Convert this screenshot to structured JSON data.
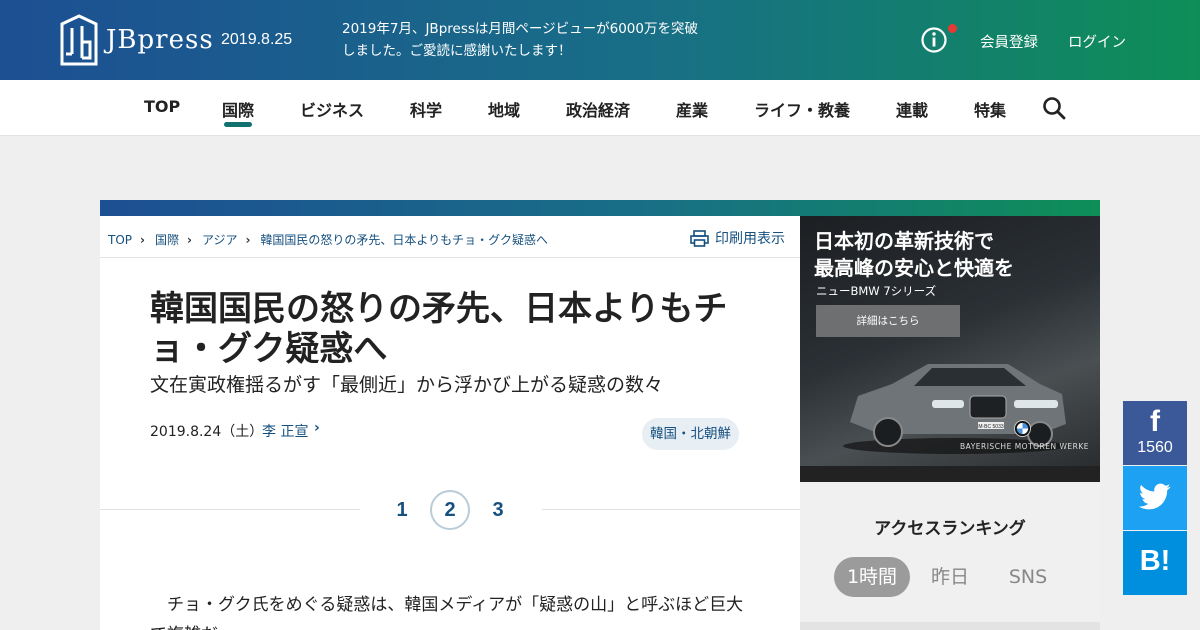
{
  "header": {
    "logo_text": "JBpress",
    "date": "2019.8.25",
    "notice": "2019年7月、JBpressは月間ページビューが6000万を突破しました。ご愛読に感謝いたします！",
    "info_icon": "info-icon",
    "register_label": "会員登録",
    "login_label": "ログイン"
  },
  "nav": {
    "items": [
      "TOP",
      "国際",
      "ビジネス",
      "科学",
      "地域",
      "政治経済",
      "産業",
      "ライフ・教養",
      "連載",
      "特集"
    ],
    "active": "国際",
    "search_icon": "search-icon"
  },
  "breadcrumb": [
    "TOP",
    "国際",
    "アジア",
    "韓国国民の怒りの矛先、日本よりもチョ・グク疑惑へ"
  ],
  "print_label": "印刷用表示",
  "article": {
    "title": "韓国国民の怒りの矛先、日本よりもチョ・グク疑惑へ",
    "subtitle": "文在寅政権揺るがす「最側近」から浮かび上がる疑惑の数々",
    "pubdate": "2019.8.24（土）",
    "author": "李 正宣",
    "tag": "韓国・北朝鮮",
    "pages": [
      "1",
      "2",
      "3"
    ],
    "current_page": "2",
    "body": "　チョ・グク氏をめぐる疑惑は、韓国メディアが「疑惑の山」と呼ぶほど巨大で複雑だ。"
  },
  "ad": {
    "headline_1": "日本初の革新技術で",
    "headline_2": "最高峰の安心と快適を",
    "sub": "ニューBMW 7シリーズ",
    "button": "詳細はこちら",
    "brand": "BAYERISCHE  MOTOREN  WERKE",
    "plate": "M·BC 5033"
  },
  "ranking": {
    "title": "アクセスランキング",
    "tabs": [
      "1時間",
      "昨日",
      "SNS"
    ],
    "active_tab": "1時間"
  },
  "share": {
    "facebook_label": "f",
    "facebook_count": "1560",
    "hatena_label": "B!"
  },
  "colors": {
    "brand_blue": "#1d4f93",
    "brand_green": "#0e8e57",
    "link": "#16507f",
    "facebook": "#3b5998",
    "twitter": "#1da1f2",
    "hatena": "#008fde"
  }
}
